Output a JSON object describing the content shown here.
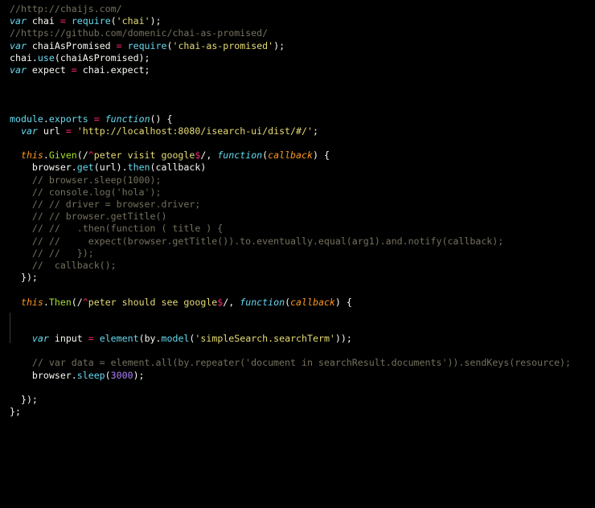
{
  "editor": {
    "theme_colors": {
      "background": "#000000",
      "comment": "#75715e",
      "keyword": "#66d9ef",
      "string": "#e6db74",
      "number": "#ae81ff",
      "operator": "#f92672",
      "plain": "#f8f8f2",
      "this": "#fd971f",
      "function_call": "#a6e22e"
    },
    "lines": [
      [
        {
          "t": "//http://chaijs.com/",
          "c": "comment"
        }
      ],
      [
        {
          "t": "var",
          "c": "storage"
        },
        {
          "t": " chai ",
          "c": "plain"
        },
        {
          "t": "=",
          "c": "operator"
        },
        {
          "t": " ",
          "c": "plain"
        },
        {
          "t": "require",
          "c": "support"
        },
        {
          "t": "(",
          "c": "punct"
        },
        {
          "t": "'chai'",
          "c": "string"
        },
        {
          "t": ");",
          "c": "punct"
        }
      ],
      [
        {
          "t": "//https://github.com/domenic/chai-as-promised/",
          "c": "comment"
        }
      ],
      [
        {
          "t": "var",
          "c": "storage"
        },
        {
          "t": " chaiAsPromised ",
          "c": "plain"
        },
        {
          "t": "=",
          "c": "operator"
        },
        {
          "t": " ",
          "c": "plain"
        },
        {
          "t": "require",
          "c": "support"
        },
        {
          "t": "(",
          "c": "punct"
        },
        {
          "t": "'chai-as-promised'",
          "c": "string"
        },
        {
          "t": ");",
          "c": "punct"
        }
      ],
      [
        {
          "t": "chai.",
          "c": "plain"
        },
        {
          "t": "use",
          "c": "support"
        },
        {
          "t": "(chaiAsPromised);",
          "c": "plain"
        }
      ],
      [
        {
          "t": "var",
          "c": "storage"
        },
        {
          "t": " expect ",
          "c": "plain"
        },
        {
          "t": "=",
          "c": "operator"
        },
        {
          "t": " chai.expect;",
          "c": "plain"
        }
      ],
      [],
      [],
      [],
      [
        {
          "t": "module",
          "c": "support"
        },
        {
          "t": ".",
          "c": "plain"
        },
        {
          "t": "exports",
          "c": "support"
        },
        {
          "t": " ",
          "c": "plain"
        },
        {
          "t": "=",
          "c": "operator"
        },
        {
          "t": " ",
          "c": "plain"
        },
        {
          "t": "function",
          "c": "storage"
        },
        {
          "t": "() {",
          "c": "plain"
        }
      ],
      [
        {
          "t": "  ",
          "c": "plain"
        },
        {
          "t": "var",
          "c": "storage"
        },
        {
          "t": " url ",
          "c": "plain"
        },
        {
          "t": "=",
          "c": "operator"
        },
        {
          "t": " ",
          "c": "plain"
        },
        {
          "t": "'http://localhost:8080/isearch-ui/dist/#/'",
          "c": "string"
        },
        {
          "t": ";",
          "c": "plain"
        }
      ],
      [],
      [
        {
          "t": "  ",
          "c": "plain"
        },
        {
          "t": "this",
          "c": "this"
        },
        {
          "t": ".",
          "c": "plain"
        },
        {
          "t": "Given",
          "c": "fn"
        },
        {
          "t": "(/",
          "c": "plain"
        },
        {
          "t": "^",
          "c": "regex-anchor"
        },
        {
          "t": "peter visit google",
          "c": "regex"
        },
        {
          "t": "$",
          "c": "regex-anchor"
        },
        {
          "t": "/, ",
          "c": "plain"
        },
        {
          "t": "function",
          "c": "storage"
        },
        {
          "t": "(",
          "c": "plain"
        },
        {
          "t": "callback",
          "c": "param"
        },
        {
          "t": ") {",
          "c": "plain"
        }
      ],
      [
        {
          "t": "    browser.",
          "c": "plain"
        },
        {
          "t": "get",
          "c": "support"
        },
        {
          "t": "(url).",
          "c": "plain"
        },
        {
          "t": "then",
          "c": "support"
        },
        {
          "t": "(callback)",
          "c": "plain"
        }
      ],
      [
        {
          "t": "    // browser.sleep(1000);",
          "c": "comment"
        }
      ],
      [
        {
          "t": "    // console.log('hola');",
          "c": "comment"
        }
      ],
      [
        {
          "t": "    // // driver = browser.driver;",
          "c": "comment"
        }
      ],
      [
        {
          "t": "    // // browser.getTitle()",
          "c": "comment"
        }
      ],
      [
        {
          "t": "    // //   .then(function ( title ) {",
          "c": "comment"
        }
      ],
      [
        {
          "t": "    // //     expect(browser.getTitle()).to.eventually.equal(arg1).and.notify(callback);",
          "c": "comment"
        }
      ],
      [
        {
          "t": "    // //   });",
          "c": "comment"
        }
      ],
      [
        {
          "t": "    //  callback();",
          "c": "comment"
        }
      ],
      [
        {
          "t": "  });",
          "c": "plain"
        }
      ],
      [],
      [
        {
          "t": "  ",
          "c": "plain"
        },
        {
          "t": "this",
          "c": "this"
        },
        {
          "t": ".",
          "c": "plain"
        },
        {
          "t": "Then",
          "c": "fn"
        },
        {
          "t": "(/",
          "c": "plain"
        },
        {
          "t": "^",
          "c": "regex-anchor"
        },
        {
          "t": "peter should see google",
          "c": "regex"
        },
        {
          "t": "$",
          "c": "regex-anchor"
        },
        {
          "t": "/, ",
          "c": "plain"
        },
        {
          "t": "function",
          "c": "storage"
        },
        {
          "t": "(",
          "c": "plain"
        },
        {
          "t": "callback",
          "c": "param"
        },
        {
          "t": ") {",
          "c": "plain"
        }
      ],
      [],
      [],
      [
        {
          "t": "    ",
          "c": "plain"
        },
        {
          "t": "var",
          "c": "storage"
        },
        {
          "t": " input ",
          "c": "plain"
        },
        {
          "t": "=",
          "c": "operator"
        },
        {
          "t": " ",
          "c": "plain"
        },
        {
          "t": "element",
          "c": "support"
        },
        {
          "t": "(by.",
          "c": "plain"
        },
        {
          "t": "model",
          "c": "support"
        },
        {
          "t": "(",
          "c": "plain"
        },
        {
          "t": "'simpleSearch.searchTerm'",
          "c": "string"
        },
        {
          "t": "));",
          "c": "plain"
        }
      ],
      [],
      [
        {
          "t": "    // var data = element.all(by.repeater('document in searchResult.documents')).sendKeys(resource);",
          "c": "comment"
        }
      ],
      [
        {
          "t": "    browser.",
          "c": "plain"
        },
        {
          "t": "sleep",
          "c": "support"
        },
        {
          "t": "(",
          "c": "plain"
        },
        {
          "t": "3000",
          "c": "number"
        },
        {
          "t": ");",
          "c": "plain"
        }
      ],
      [],
      [
        {
          "t": "  });",
          "c": "plain"
        }
      ],
      [
        {
          "t": "};",
          "c": "plain"
        }
      ]
    ]
  }
}
